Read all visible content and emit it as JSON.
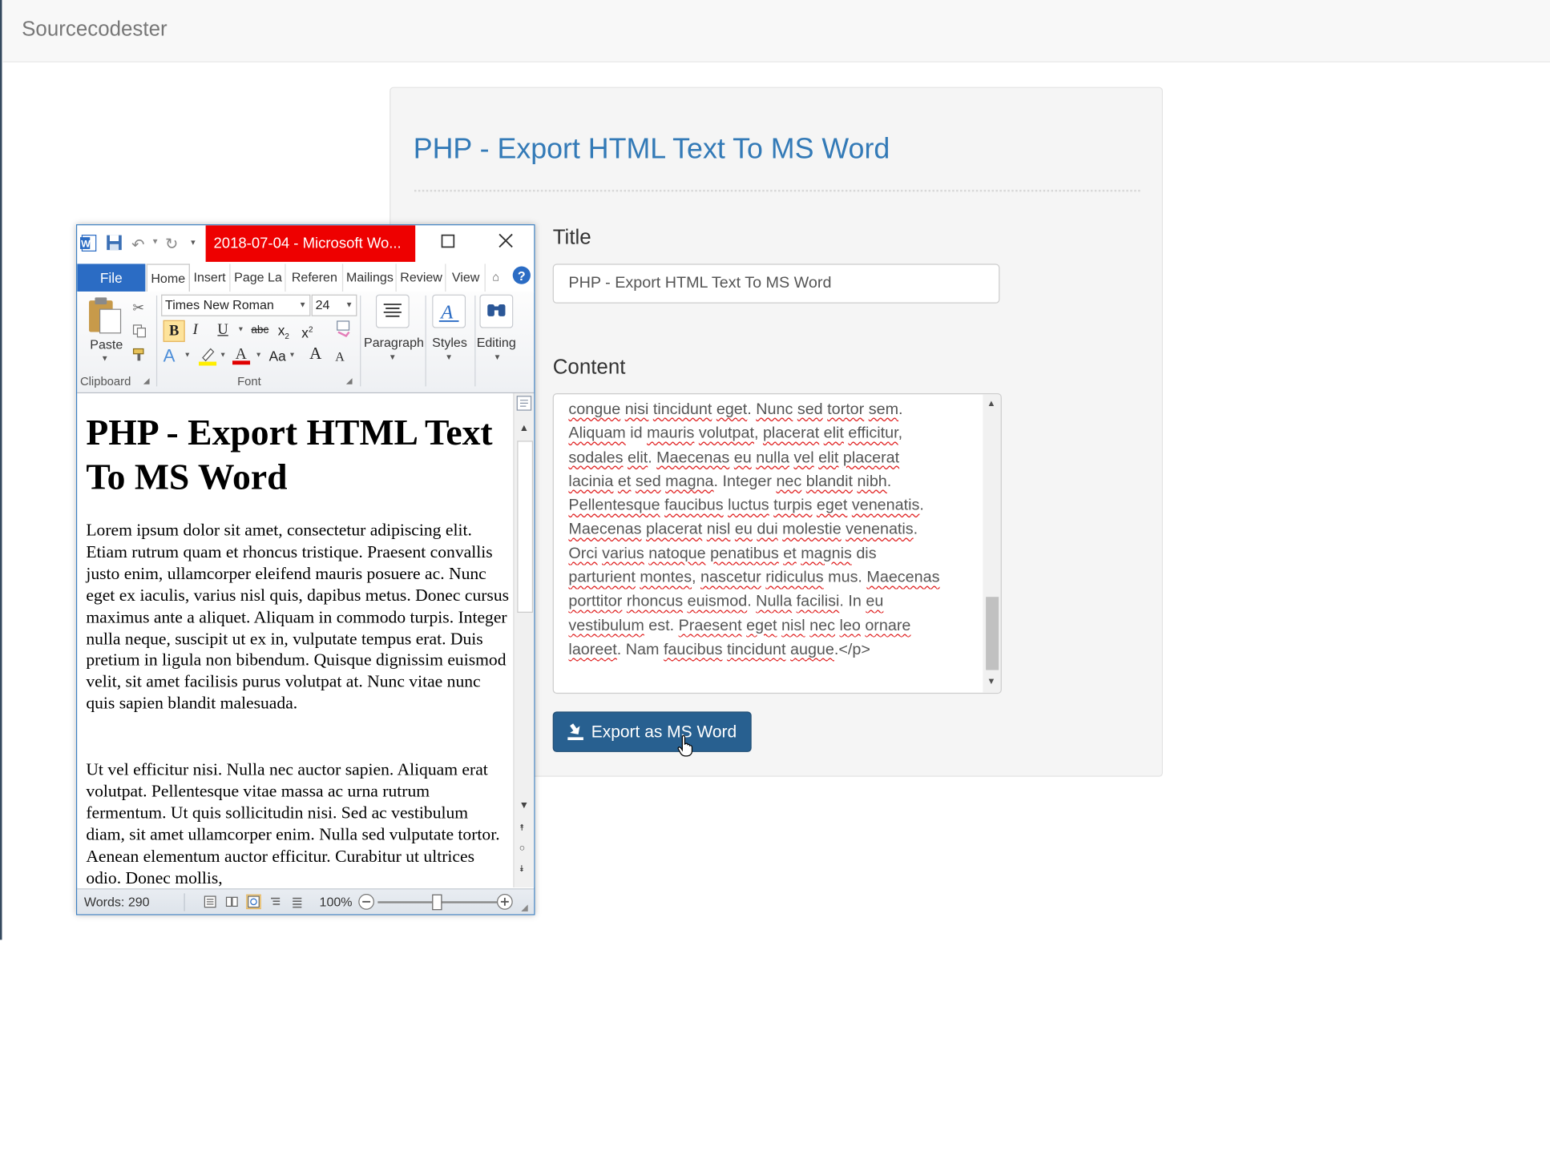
{
  "navbar": {
    "brand": "Sourcecodester"
  },
  "page": {
    "heading": "PHP - Export HTML Text To MS Word",
    "title_label": "Title",
    "title_value": "PHP - Export HTML Text To MS Word",
    "content_label": "Content",
    "content_lines": [
      [
        {
          "t": "congue",
          "s": 1
        },
        {
          "t": " "
        },
        {
          "t": "nisi",
          "s": 1
        },
        {
          "t": " "
        },
        {
          "t": "tincidunt",
          "s": 1
        },
        {
          "t": " "
        },
        {
          "t": "eget",
          "s": 1
        },
        {
          "t": ". "
        },
        {
          "t": "Nunc",
          "s": 1
        },
        {
          "t": " "
        },
        {
          "t": "sed",
          "s": 1
        },
        {
          "t": " "
        },
        {
          "t": "tortor",
          "s": 1
        },
        {
          "t": " "
        },
        {
          "t": "sem",
          "s": 1
        },
        {
          "t": "."
        }
      ],
      [
        {
          "t": "Aliquam",
          "s": 1
        },
        {
          "t": " id "
        },
        {
          "t": "mauris",
          "s": 1
        },
        {
          "t": " "
        },
        {
          "t": "volutpat",
          "s": 1
        },
        {
          "t": ", "
        },
        {
          "t": "placerat",
          "s": 1
        },
        {
          "t": " "
        },
        {
          "t": "elit",
          "s": 1
        },
        {
          "t": " "
        },
        {
          "t": "efficitur",
          "s": 1
        },
        {
          "t": ","
        }
      ],
      [
        {
          "t": "sodales",
          "s": 1
        },
        {
          "t": " "
        },
        {
          "t": "elit",
          "s": 1
        },
        {
          "t": ". "
        },
        {
          "t": "Maecenas",
          "s": 1
        },
        {
          "t": " "
        },
        {
          "t": "eu",
          "s": 1
        },
        {
          "t": " "
        },
        {
          "t": "nulla",
          "s": 1
        },
        {
          "t": " "
        },
        {
          "t": "vel",
          "s": 1
        },
        {
          "t": " "
        },
        {
          "t": "elit",
          "s": 1
        },
        {
          "t": " "
        },
        {
          "t": "placerat",
          "s": 1
        }
      ],
      [
        {
          "t": "lacinia",
          "s": 1
        },
        {
          "t": " "
        },
        {
          "t": "et",
          "s": 1
        },
        {
          "t": " "
        },
        {
          "t": "sed",
          "s": 1
        },
        {
          "t": " "
        },
        {
          "t": "magna",
          "s": 1
        },
        {
          "t": ". Integer "
        },
        {
          "t": "nec",
          "s": 1
        },
        {
          "t": " "
        },
        {
          "t": "blandit",
          "s": 1
        },
        {
          "t": " "
        },
        {
          "t": "nibh",
          "s": 1
        },
        {
          "t": "."
        }
      ],
      [
        {
          "t": "Pellentesque",
          "s": 1
        },
        {
          "t": " "
        },
        {
          "t": "faucibus",
          "s": 1
        },
        {
          "t": " "
        },
        {
          "t": "luctus",
          "s": 1
        },
        {
          "t": " "
        },
        {
          "t": "turpis",
          "s": 1
        },
        {
          "t": " "
        },
        {
          "t": "eget",
          "s": 1
        },
        {
          "t": " "
        },
        {
          "t": "venenatis",
          "s": 1
        },
        {
          "t": "."
        }
      ],
      [
        {
          "t": "Maecenas",
          "s": 1
        },
        {
          "t": " "
        },
        {
          "t": "placerat",
          "s": 1
        },
        {
          "t": " "
        },
        {
          "t": "nisl",
          "s": 1
        },
        {
          "t": " "
        },
        {
          "t": "eu",
          "s": 1
        },
        {
          "t": " "
        },
        {
          "t": "dui",
          "s": 1
        },
        {
          "t": " "
        },
        {
          "t": "molestie",
          "s": 1
        },
        {
          "t": " "
        },
        {
          "t": "venenatis",
          "s": 1
        },
        {
          "t": "."
        }
      ],
      [
        {
          "t": "Orci",
          "s": 1
        },
        {
          "t": " "
        },
        {
          "t": "varius",
          "s": 1
        },
        {
          "t": " "
        },
        {
          "t": "natoque",
          "s": 1
        },
        {
          "t": " "
        },
        {
          "t": "penatibus",
          "s": 1
        },
        {
          "t": " "
        },
        {
          "t": "et",
          "s": 1
        },
        {
          "t": " "
        },
        {
          "t": "magnis",
          "s": 1
        },
        {
          "t": " dis"
        }
      ],
      [
        {
          "t": "parturient",
          "s": 1
        },
        {
          "t": " "
        },
        {
          "t": "montes",
          "s": 1
        },
        {
          "t": ", "
        },
        {
          "t": "nascetur",
          "s": 1
        },
        {
          "t": " "
        },
        {
          "t": "ridiculus",
          "s": 1
        },
        {
          "t": " mus. "
        },
        {
          "t": "Maecenas",
          "s": 1
        }
      ],
      [
        {
          "t": "porttitor",
          "s": 1
        },
        {
          "t": " "
        },
        {
          "t": "rhoncus",
          "s": 1
        },
        {
          "t": " "
        },
        {
          "t": "euismod",
          "s": 1
        },
        {
          "t": ". "
        },
        {
          "t": "Nulla",
          "s": 1
        },
        {
          "t": " "
        },
        {
          "t": "facilisi",
          "s": 1
        },
        {
          "t": ". In "
        },
        {
          "t": "eu",
          "s": 1
        }
      ],
      [
        {
          "t": "vestibulum",
          "s": 1
        },
        {
          "t": " est. "
        },
        {
          "t": "Praesent",
          "s": 1
        },
        {
          "t": " "
        },
        {
          "t": "eget",
          "s": 1
        },
        {
          "t": " "
        },
        {
          "t": "nisl",
          "s": 1
        },
        {
          "t": " "
        },
        {
          "t": "nec",
          "s": 1
        },
        {
          "t": " "
        },
        {
          "t": "leo",
          "s": 1
        },
        {
          "t": " "
        },
        {
          "t": "ornare",
          "s": 1
        }
      ],
      [
        {
          "t": "laoreet",
          "s": 1
        },
        {
          "t": ". Nam "
        },
        {
          "t": "faucibus",
          "s": 1
        },
        {
          "t": " "
        },
        {
          "t": "tincidunt",
          "s": 1
        },
        {
          "t": " "
        },
        {
          "t": "augue",
          "s": 1
        },
        {
          "t": ".</p>"
        }
      ]
    ],
    "export_button": "Export as MS Word"
  },
  "word": {
    "window_title": "2018-07-04 - Microsoft Wo...",
    "tabs": {
      "file": "File",
      "home": "Home",
      "insert": "Insert",
      "page_layout": "Page La",
      "references": "Referen",
      "mailings": "Mailings",
      "review": "Review",
      "view": "View"
    },
    "clipboard": {
      "paste": "Paste",
      "label": "Clipboard"
    },
    "font": {
      "name": "Times New Roman",
      "size": "24",
      "label": "Font",
      "bold": "B",
      "italic": "I",
      "underline": "U",
      "strike": "abc",
      "grow": "A",
      "shrink": "A",
      "case": "Aa"
    },
    "paragraph_label": "Paragraph",
    "styles_label": "Styles",
    "editing_label": "Editing",
    "doc": {
      "heading": "PHP - Export HTML Text To MS Word",
      "para1": "Lorem ipsum dolor sit amet, consectetur adipiscing elit. Etiam rutrum quam et rhoncus tristique. Praesent convallis justo enim, ullamcorper eleifend mauris posuere ac. Nunc eget ex iaculis, varius nisl quis, dapibus metus. Donec cursus maximus ante a aliquet. Aliquam in commodo turpis. Integer nulla neque, suscipit ut ex in, vulputate tempus erat. Duis pretium in ligula non bibendum. Quisque dignissim euismod velit, sit amet facilisis purus volutpat at. Nunc vitae nunc quis sapien blandit malesuada.",
      "para2": "Ut vel efficitur nisi. Nulla nec auctor sapien. Aliquam erat volutpat. Pellentesque vitae massa ac urna rutrum fermentum. Ut quis sollicitudin nisi. Sed ac vestibulum diam, sit amet ullamcorper enim. Nulla sed vulputate tortor. Aenean elementum auctor efficitur. Curabitur ut ultrices odio. Donec mollis,"
    },
    "status": {
      "words": "Words: 290",
      "zoom": "100%"
    }
  },
  "colors": {
    "accent": "#337ab7",
    "button": "#286090",
    "word_title_bg": "#ee0000",
    "word_file_tab": "#2b6cc4"
  }
}
